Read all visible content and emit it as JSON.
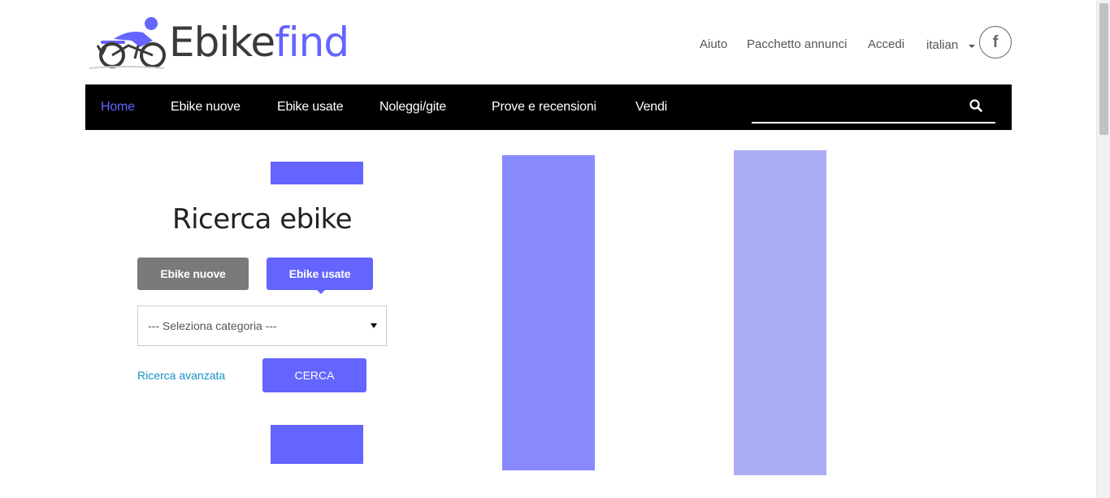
{
  "header": {
    "logo": {
      "part1": "Ebike",
      "part2": "find"
    },
    "links": {
      "aiuto": "Aiuto",
      "pacchetto": "Pacchetto annunci",
      "accedi": "Accedi"
    },
    "language": "italian",
    "social_icon": "facebook-icon"
  },
  "nav": {
    "items": [
      {
        "label": "Home",
        "active": true
      },
      {
        "label": "Ebike nuove",
        "active": false
      },
      {
        "label": "Ebike usate",
        "active": false
      },
      {
        "label": "Noleggi/gite",
        "active": false
      },
      {
        "label": "Prove e recensioni",
        "active": false
      },
      {
        "label": "Vendi",
        "active": false
      }
    ],
    "search_value": "",
    "search_icon": "search-icon"
  },
  "search_panel": {
    "title": "Ricerca ebike",
    "tab_new": "Ebike nuove",
    "tab_used": "Ebike usate",
    "selected_tab": "Ebike usate",
    "category_select": "--- Seleziona categoria ---",
    "advanced_link": "Ricerca avanzata",
    "search_button": "CERCA"
  },
  "colors": {
    "accent": "#6464ff",
    "navbar": "#000000",
    "tab_inactive": "#7a7a7a",
    "link": "#1a8fc4",
    "bar_1": "#8a8aff",
    "bar_2": "#acacf5"
  }
}
